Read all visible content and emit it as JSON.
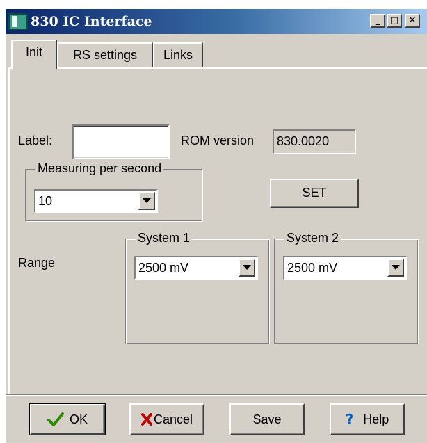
{
  "window": {
    "title": "830 IC Interface",
    "icon": "app-icon",
    "controls": {
      "minimize": "_",
      "maximize": "□",
      "close": "✕"
    }
  },
  "tabs": [
    {
      "label": "Init",
      "active": true
    },
    {
      "label": "RS settings",
      "active": false
    },
    {
      "label": "Links",
      "active": false
    }
  ],
  "init": {
    "label_caption": "Label:",
    "label_value": "",
    "rom_caption": "ROM version",
    "rom_value": "830.0020",
    "measuring_group": "Measuring per second",
    "measuring_value": "10",
    "set_button": "SET",
    "range_caption": "Range",
    "system1_group": "System 1",
    "system1_value": "2500 mV",
    "system2_group": "System 2",
    "system2_value": "2500 mV"
  },
  "buttons": {
    "ok": "OK",
    "cancel": "Cancel",
    "save": "Save",
    "help": "Help"
  },
  "colors": {
    "face": "#d4d0c8",
    "titlebar_start": "#0a246a",
    "titlebar_end": "#a6caf0",
    "ok_check": "#2e8b00",
    "cancel_x": "#c00000",
    "help_q": "#0060c0"
  }
}
